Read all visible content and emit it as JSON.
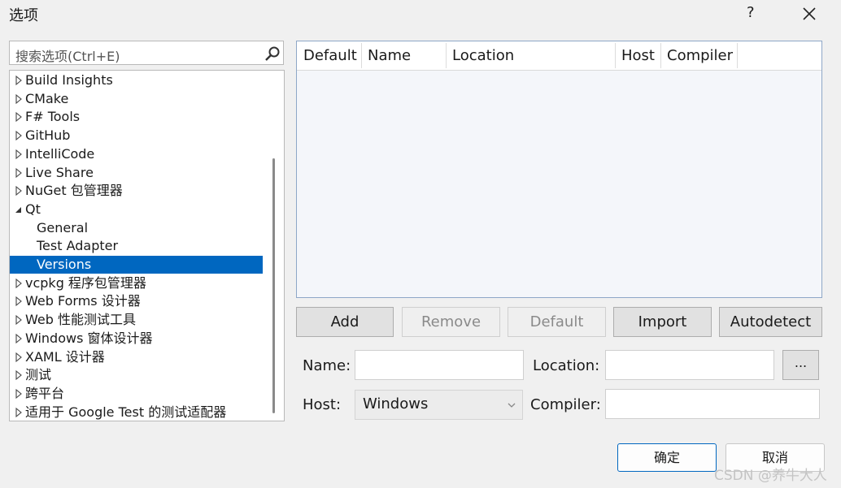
{
  "window": {
    "title": "选项",
    "help": "?"
  },
  "search": {
    "placeholder": "搜索选项(Ctrl+E)"
  },
  "tree": {
    "items": [
      {
        "label": "Build Insights",
        "state": "collapsed"
      },
      {
        "label": "CMake",
        "state": "collapsed"
      },
      {
        "label": "F# Tools",
        "state": "collapsed"
      },
      {
        "label": "GitHub",
        "state": "collapsed"
      },
      {
        "label": "IntelliCode",
        "state": "collapsed"
      },
      {
        "label": "Live Share",
        "state": "collapsed"
      },
      {
        "label": "NuGet 包管理器",
        "state": "collapsed"
      },
      {
        "label": "Qt",
        "state": "expanded"
      },
      {
        "label": "General",
        "state": "child"
      },
      {
        "label": "Test Adapter",
        "state": "child"
      },
      {
        "label": "Versions",
        "state": "child-selected"
      },
      {
        "label": "vcpkg 程序包管理器",
        "state": "collapsed"
      },
      {
        "label": "Web Forms 设计器",
        "state": "collapsed"
      },
      {
        "label": "Web 性能测试工具",
        "state": "collapsed"
      },
      {
        "label": "Windows 窗体设计器",
        "state": "collapsed"
      },
      {
        "label": "XAML 设计器",
        "state": "collapsed"
      },
      {
        "label": "测试",
        "state": "collapsed"
      },
      {
        "label": "跨平台",
        "state": "collapsed"
      },
      {
        "label": "适用于 Google Test 的测试适配器",
        "state": "collapsed"
      }
    ]
  },
  "grid": {
    "columns": [
      "Default",
      "Name",
      "Location",
      "Host",
      "Compiler"
    ]
  },
  "buttons": {
    "add": "Add",
    "remove": "Remove",
    "default": "Default",
    "import": "Import",
    "autodetect": "Autodetect",
    "browse": "..."
  },
  "form": {
    "name_label": "Name:",
    "location_label": "Location:",
    "host_label": "Host:",
    "host_value": "Windows",
    "compiler_label": "Compiler:"
  },
  "footer": {
    "ok": "确定",
    "cancel": "取消"
  },
  "watermark": "CSDN @养牛大人",
  "colors": {
    "selection": "#0067c0",
    "accent_border": "#0067c0"
  }
}
